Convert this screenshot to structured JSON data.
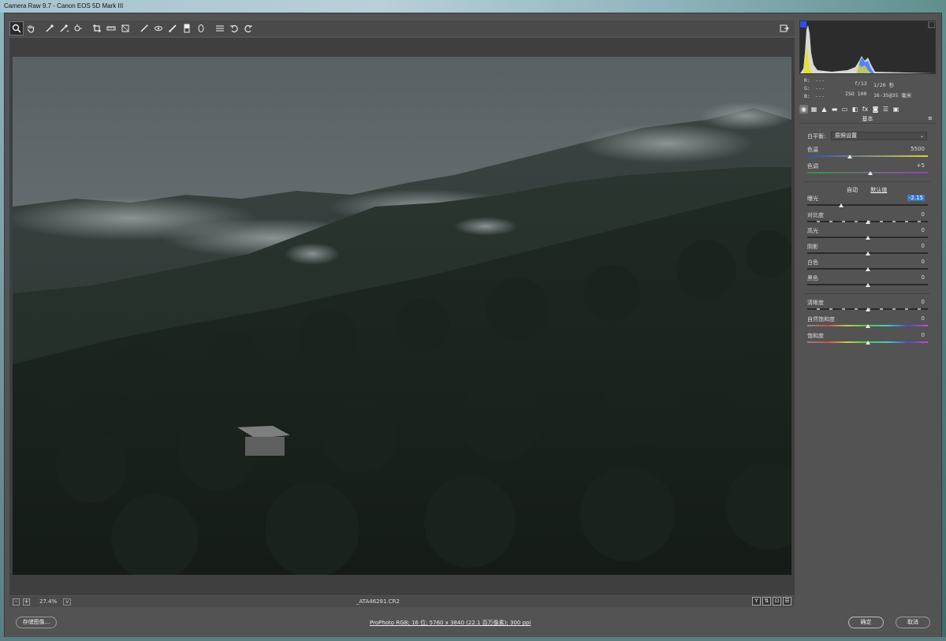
{
  "window": {
    "title": "Camera Raw 9.7 -  Canon EOS 5D Mark III"
  },
  "toolbar": {
    "tools": [
      {
        "name": "zoom-tool",
        "glyph": "🔍"
      },
      {
        "name": "hand-tool",
        "glyph": "✋"
      },
      {
        "name": "white-balance-tool",
        "glyph": "⁄"
      },
      {
        "name": "color-sampler-tool",
        "glyph": "✎"
      },
      {
        "name": "targeted-adjustment-tool",
        "glyph": "⊚"
      },
      {
        "name": "crop-tool",
        "glyph": "⌗"
      },
      {
        "name": "straighten-tool",
        "glyph": "▭"
      },
      {
        "name": "transform-tool",
        "glyph": "◫"
      },
      {
        "name": "spot-removal-tool",
        "glyph": "✓"
      },
      {
        "name": "red-eye-tool",
        "glyph": "⊕"
      },
      {
        "name": "adjustment-brush-tool",
        "glyph": "/"
      },
      {
        "name": "graduated-filter-tool",
        "glyph": "▮"
      },
      {
        "name": "radial-filter-tool",
        "glyph": "○"
      },
      {
        "name": "preferences-tool",
        "glyph": "≡"
      },
      {
        "name": "rotate-left-tool",
        "glyph": "↺"
      },
      {
        "name": "rotate-right-tool",
        "glyph": "↻"
      }
    ],
    "fullscreen_glyph": "⇥"
  },
  "info": {
    "r_label": "R:",
    "g_label": "G:",
    "b_label": "B:",
    "r_val": "---",
    "g_val": "---",
    "b_val": "---",
    "aperture": "f/13",
    "shutter": "1/20 秒",
    "iso": "ISO 100",
    "lens": "16-35@35 毫米"
  },
  "panel": {
    "title": "基本",
    "menu_glyph": "≡",
    "tabs": [
      "◉",
      "▦",
      "▲",
      "▬",
      "▭",
      "◧",
      "fx",
      "◙",
      "☰",
      "▣"
    ],
    "white_balance_label": "白平衡:",
    "white_balance_value": "原照设置",
    "auto_label": "自动",
    "default_label": "默认值",
    "sliders": {
      "temp": {
        "label": "色温",
        "value": "5500",
        "pos": 0.35
      },
      "tint": {
        "label": "色调",
        "value": "+5",
        "pos": 0.52
      },
      "exposure": {
        "label": "曝光",
        "value": "-2.15",
        "pos": 0.28
      },
      "contrast": {
        "label": "对比度",
        "value": "0",
        "pos": 0.5
      },
      "highlights": {
        "label": "高光",
        "value": "0",
        "pos": 0.5
      },
      "shadows": {
        "label": "阴影",
        "value": "0",
        "pos": 0.5
      },
      "whites": {
        "label": "白色",
        "value": "0",
        "pos": 0.5
      },
      "blacks": {
        "label": "黑色",
        "value": "0",
        "pos": 0.5
      },
      "clarity": {
        "label": "清晰度",
        "value": "0",
        "pos": 0.5
      },
      "vibrance": {
        "label": "自然饱和度",
        "value": "0",
        "pos": 0.5
      },
      "saturation": {
        "label": "饱和度",
        "value": "0",
        "pos": 0.5
      }
    }
  },
  "status": {
    "zoom_minus": "-",
    "zoom_plus": "+",
    "zoom": "27.4%",
    "zoom_drop": "v",
    "filename": "_ATA46281.CR2",
    "view_buttons": [
      "Y",
      "⇅",
      "⊡",
      "☰"
    ]
  },
  "bottom": {
    "save_label": "存储图像...",
    "workflow": "ProPhoto RGB; 16 位; 5760 x 3840 (22.1 百万像素); 300 ppi",
    "ok_label": "确定",
    "cancel_label": "取消"
  }
}
